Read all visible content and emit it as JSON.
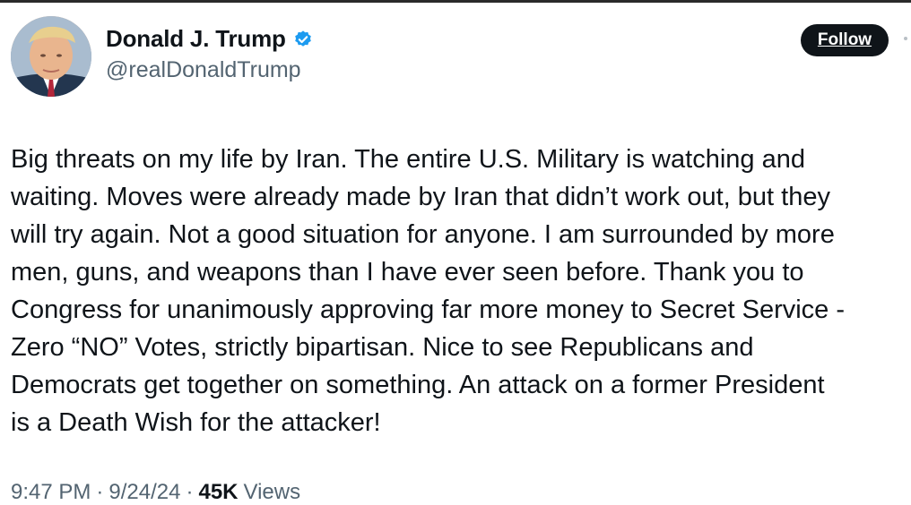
{
  "author": {
    "display_name": "Donald J. Trump",
    "handle": "@realDonaldTrump",
    "verified": true,
    "verified_color": "#1d9bf0"
  },
  "actions": {
    "follow_label": "Follow"
  },
  "tweet": {
    "lines": [
      "Big threats on my life by Iran. The entire U.S. Military is watching and",
      "waiting. Moves were already made by Iran that didn’t work out, but they",
      "will try again. Not a good situation for anyone. I am surrounded by more",
      "men, guns, and weapons than I have ever seen before. Thank you to",
      "Congress for unanimously approving far more money to Secret Service -",
      "Zero “NO” Votes, strictly bipartisan. Nice to see Republicans and",
      "Democrats get together on something. An attack on a former President",
      "is a Death Wish for the attacker!"
    ]
  },
  "meta": {
    "time": "9:47 PM",
    "separator": "·",
    "date": "9/24/24",
    "views_count": "45K",
    "views_label": "Views"
  },
  "colors": {
    "text_primary": "#0f1419",
    "text_secondary": "#536471",
    "button_bg": "#0f1419"
  },
  "icons": {
    "avatar": "profile-photo",
    "verified": "verified-badge-icon",
    "more": "more-options-icon"
  }
}
